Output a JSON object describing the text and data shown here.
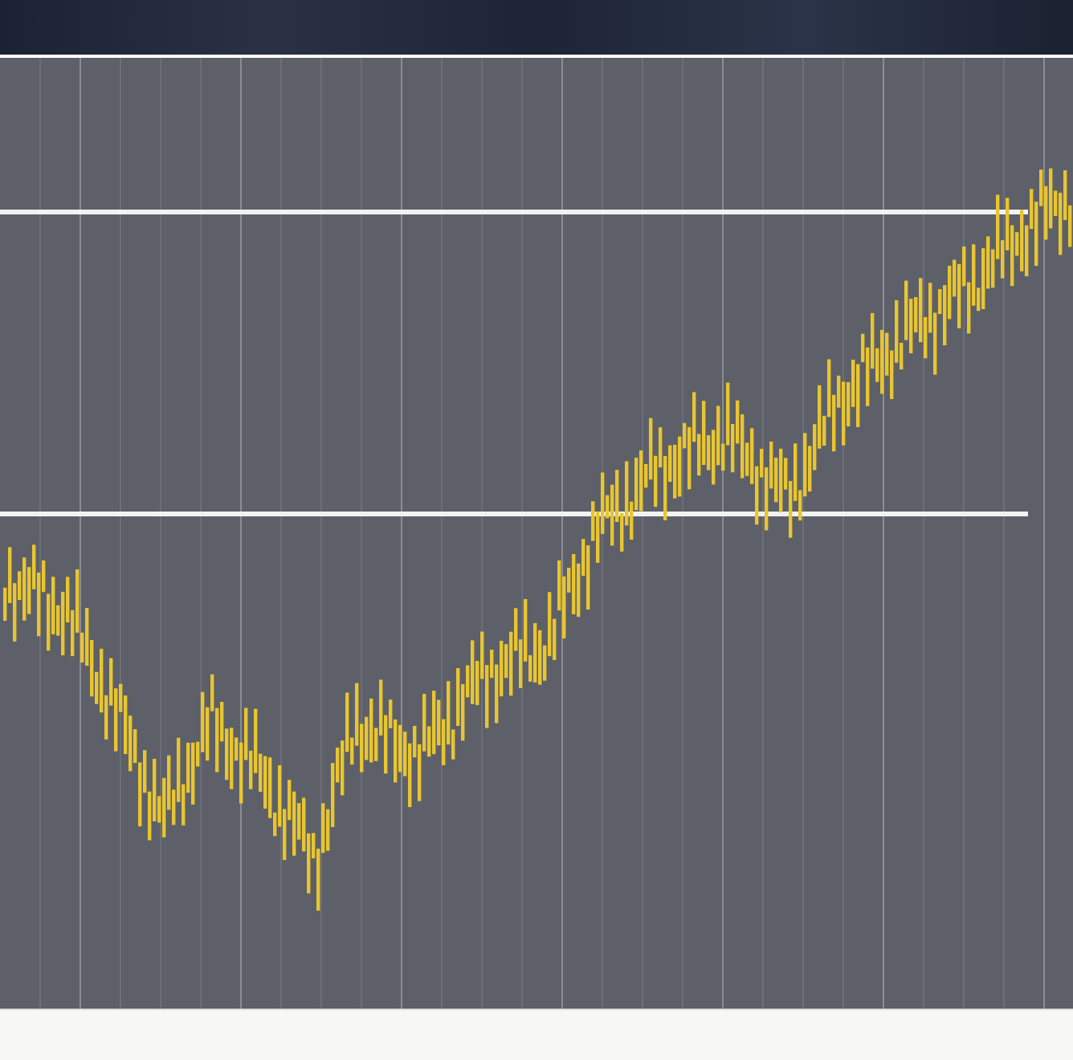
{
  "header": {
    "kind": "banner"
  },
  "plot": {
    "kind": "price_bars"
  },
  "reference_lines": [
    {
      "kind": "horizontal"
    },
    {
      "kind": "horizontal"
    }
  ],
  "footer": {
    "kind": "status_strip"
  }
}
